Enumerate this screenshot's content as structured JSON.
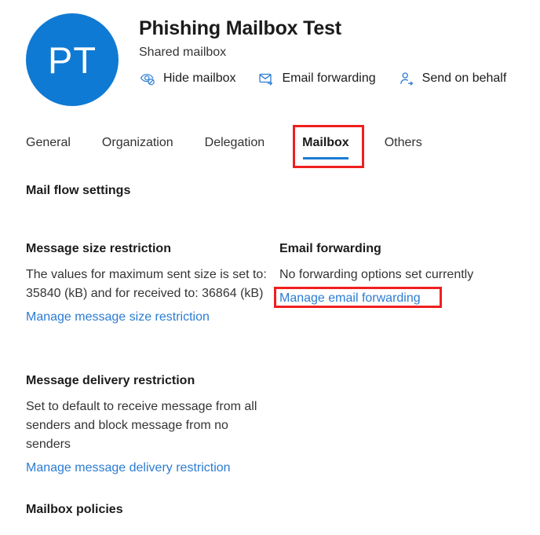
{
  "header": {
    "avatar_initials": "PT",
    "avatar_color": "#0f7ad3",
    "title": "Phishing Mailbox Test",
    "subtitle": "Shared mailbox",
    "actions": [
      {
        "label": "Hide mailbox",
        "icon": "eye-hidden-icon"
      },
      {
        "label": "Email forwarding",
        "icon": "envelope-forward-icon"
      },
      {
        "label": "Send on behalf",
        "icon": "person-arrow-icon"
      }
    ]
  },
  "tabs": {
    "active": "Mailbox",
    "active_underline_color": "#1b7ad4",
    "items": [
      {
        "label": "General"
      },
      {
        "label": "Organization"
      },
      {
        "label": "Delegation"
      },
      {
        "label": "Mailbox"
      },
      {
        "label": "Others"
      }
    ]
  },
  "annotations": {
    "color": "#f01f1f",
    "items": [
      {
        "target": "Mailbox"
      },
      {
        "target": "Manage email forwarding"
      }
    ]
  },
  "main": {
    "mail_flow_heading": "Mail flow settings",
    "mailbox_policies_heading": "Mailbox policies",
    "link_color": "#2b7cd3",
    "message_size": {
      "title": "Message size restriction",
      "body": "The values for maximum sent size is set to: 35840 (kB) and for received to: 36864 (kB)",
      "link": "Manage message size restriction"
    },
    "email_forwarding": {
      "title": "Email forwarding",
      "body": "No forwarding options set currently",
      "link": "Manage email forwarding"
    },
    "message_delivery": {
      "title": "Message delivery restriction",
      "body": "Set to default to receive message from all senders and block message from no senders",
      "link": "Manage message delivery restriction"
    }
  }
}
